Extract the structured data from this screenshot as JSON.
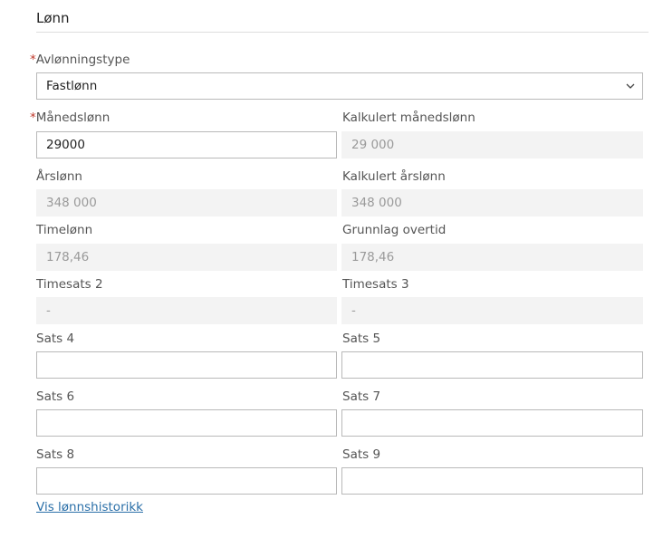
{
  "section": {
    "title": "Lønn"
  },
  "required_marker": "*",
  "fields": {
    "avlonningstype": {
      "label": "Avlønningstype",
      "value": "Fastlønn"
    },
    "manedslonn": {
      "label": "Månedslønn",
      "value": "29000"
    },
    "kalkulert_manedslonn": {
      "label": "Kalkulert månedslønn",
      "value": "29 000"
    },
    "arslonn": {
      "label": "Årslønn",
      "value": "348 000"
    },
    "kalkulert_arslonn": {
      "label": "Kalkulert årslønn",
      "value": "348 000"
    },
    "timelonn": {
      "label": "Timelønn",
      "value": "178,46"
    },
    "grunnlag_overtid": {
      "label": "Grunnlag overtid",
      "value": "178,46"
    },
    "timesats2": {
      "label": "Timesats 2",
      "value": "-"
    },
    "timesats3": {
      "label": "Timesats 3",
      "value": "-"
    },
    "sats4": {
      "label": "Sats 4",
      "value": ""
    },
    "sats5": {
      "label": "Sats 5",
      "value": ""
    },
    "sats6": {
      "label": "Sats 6",
      "value": ""
    },
    "sats7": {
      "label": "Sats 7",
      "value": ""
    },
    "sats8": {
      "label": "Sats 8",
      "value": ""
    },
    "sats9": {
      "label": "Sats 9",
      "value": ""
    }
  },
  "links": {
    "history": "Vis lønnshistorikk"
  },
  "icons": {
    "select_chevron": "chevron-down-icon"
  },
  "colors": {
    "required": "#c0392b",
    "link": "#2a6fa8",
    "readonly_bg": "#f3f3f3"
  }
}
